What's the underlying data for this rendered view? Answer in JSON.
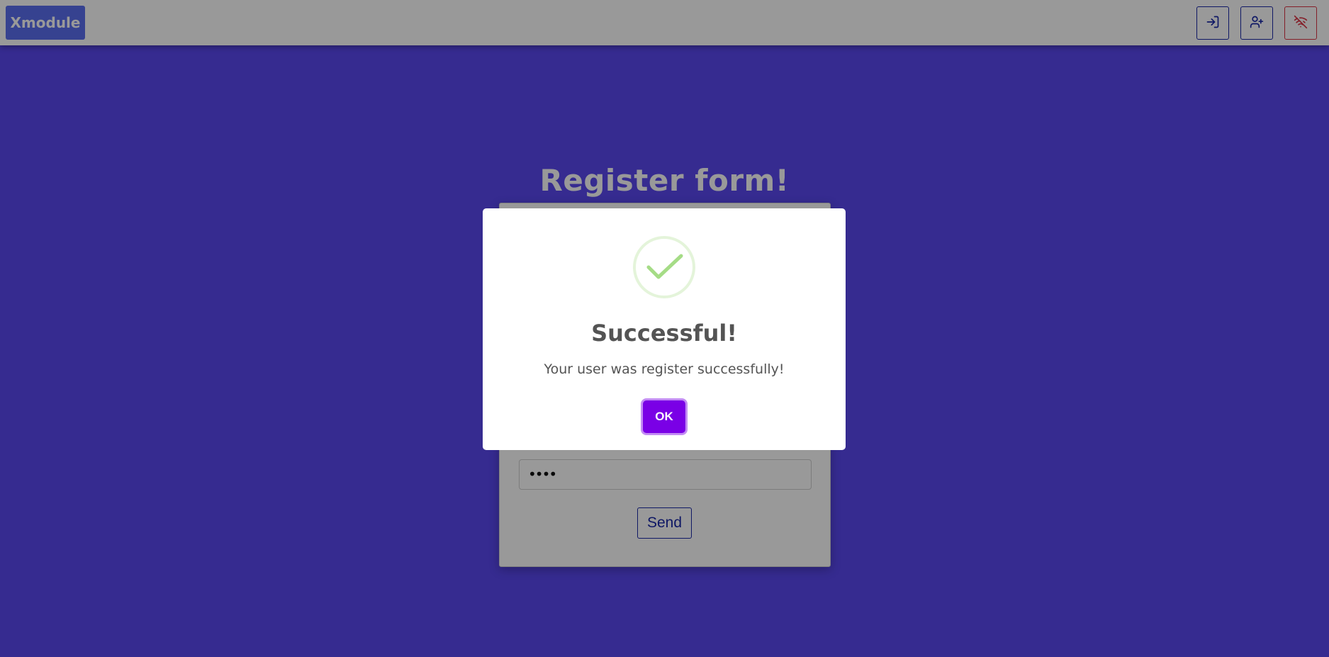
{
  "header": {
    "brand": "Xmodule",
    "buttons": [
      {
        "icon": "login-icon"
      },
      {
        "icon": "add-user-icon"
      },
      {
        "icon": "wifi-off-icon"
      }
    ]
  },
  "page": {
    "title": "Register form!",
    "password_value": "••••",
    "send_label": "Send"
  },
  "modal": {
    "icon": "success-check-icon",
    "title": "Successful!",
    "message": "Your user was register successfully!",
    "ok_label": "OK"
  },
  "colors": {
    "background": "#5a48f0",
    "brand": "#5b6ff0",
    "primary_outline": "#1a28a8",
    "danger": "#dc3545",
    "confirm_button": "#7a00e6",
    "success": "#a5dc86"
  }
}
